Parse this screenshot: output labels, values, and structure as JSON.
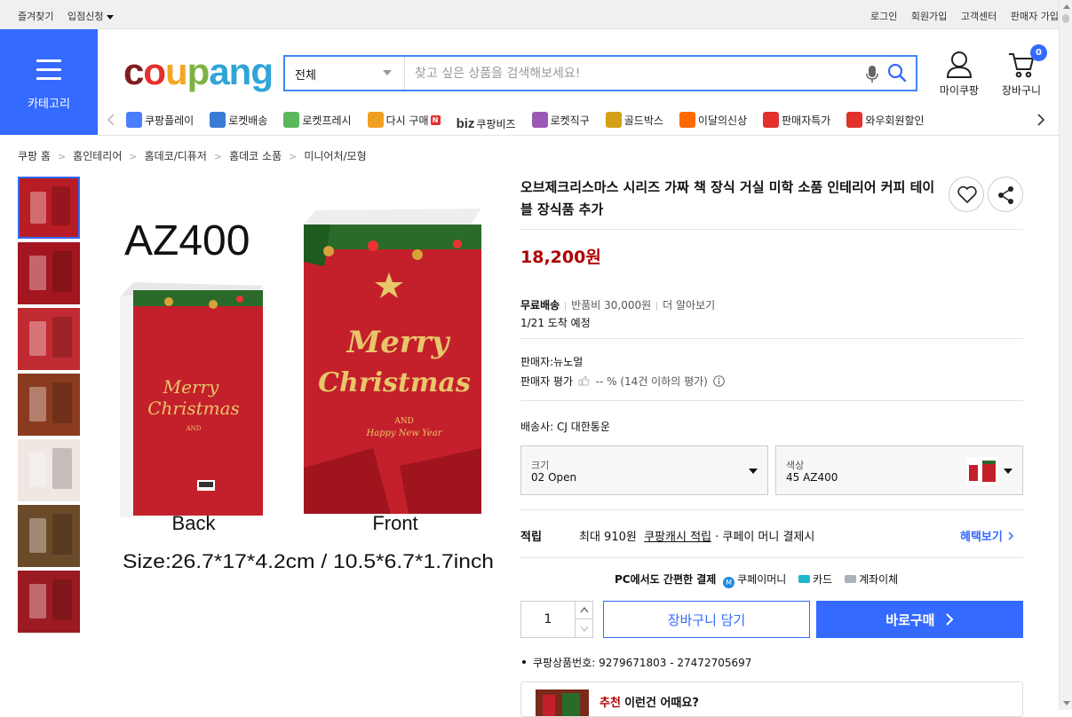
{
  "topbar": {
    "left": [
      "즐겨찾기",
      "입점신청"
    ],
    "right": [
      "로그인",
      "회원가입",
      "고객센터",
      "판매자 가입"
    ]
  },
  "header": {
    "category_label": "카테고리",
    "logo_text": [
      "c",
      "o",
      "u",
      "p",
      "ang"
    ],
    "search": {
      "scope": "전체",
      "placeholder": "찾고 싶은 상품을 검색해보세요!"
    },
    "mycoupang_label": "마이쿠팡",
    "cart_label": "장바구니",
    "cart_count": "0"
  },
  "nav": {
    "items": [
      {
        "label": "쿠팡플레이",
        "icon": "play-icon",
        "color": "#4a7dff"
      },
      {
        "label": "로켓배송",
        "icon": "rocket-icon",
        "color": "#3a7bd5"
      },
      {
        "label": "로켓프레시",
        "icon": "rocket-fresh-icon",
        "color": "#5cb85c"
      },
      {
        "label": "다시 구매",
        "icon": "rebuy-icon",
        "color": "#f0a020",
        "badge": "N"
      },
      {
        "label": "쿠팡비즈",
        "icon": "biz-icon",
        "prefix": "biz"
      },
      {
        "label": "로켓직구",
        "icon": "rocket-global-icon",
        "color": "#9b59b6"
      },
      {
        "label": "골드박스",
        "icon": "goldbox-icon",
        "color": "#d4a017"
      },
      {
        "label": "이달의신상",
        "icon": "shopping-bag-icon",
        "color": "#ff6a00"
      },
      {
        "label": "판매자특가",
        "icon": "percent-icon",
        "color": "#e3312d"
      },
      {
        "label": "와우회원할인",
        "icon": "wow-icon",
        "color": "#e3312d"
      }
    ]
  },
  "breadcrumb": [
    "쿠팡 홈",
    "홈인테리어",
    "홈데코/디퓨저",
    "홈데코 소품",
    "미니어처/모형"
  ],
  "thumbnails": [
    "#b81c25",
    "#a3161f",
    "#c02a30",
    "#8a3b1f",
    "#efe7e2",
    "#6b4a2a",
    "#9c1b22"
  ],
  "product_image": {
    "model": "AZ400",
    "back_label": "Back",
    "front_label": "Front",
    "size_text": "Size:26.7*17*4.2cm / 10.5*6.7*1.7inch",
    "cover_line1": "Merry",
    "cover_line2": "Christmas",
    "cover_sub": "AND",
    "cover_sub2": "Happy New Year"
  },
  "product": {
    "title": "오브제크리스마스 시리즈 가짜 책 장식 거실 미학 소품 인테리어 커피 테이블 장식품 추가",
    "price": "18,200원",
    "shipping": {
      "free": "무료배송",
      "return_fee": "반품비 30,000원",
      "more": "더 알아보기",
      "arrival": "1/21 도착 예정"
    },
    "seller": "판매자:뉴노멀",
    "seller_rating_label": "판매자 평가",
    "seller_rating_value": "-- % (14건 이하의 평가)",
    "courier": "배송사:  CJ 대한통운",
    "options": {
      "size_label": "크기",
      "size_value": "02 Open",
      "color_label": "색상",
      "color_value": "45 AZ400"
    },
    "reward": {
      "label": "적립",
      "text1": "최대 910원",
      "text2": "쿠팡캐시 적립",
      "text3": " · 쿠페이 머니 결제시",
      "benefit": "혜택보기"
    },
    "payment": {
      "lead": "PC에서도 간편한 결제",
      "methods": [
        "쿠페이머니",
        "카드",
        "계좌이체"
      ]
    },
    "quantity": "1",
    "add_to_cart": "장바구니 담기",
    "buy_now": "바로구매",
    "product_number": "쿠팡상품번호: 9279671803 - 27472705697",
    "reco_prefix": "추천",
    "reco_text": "이런건 어때요?"
  }
}
